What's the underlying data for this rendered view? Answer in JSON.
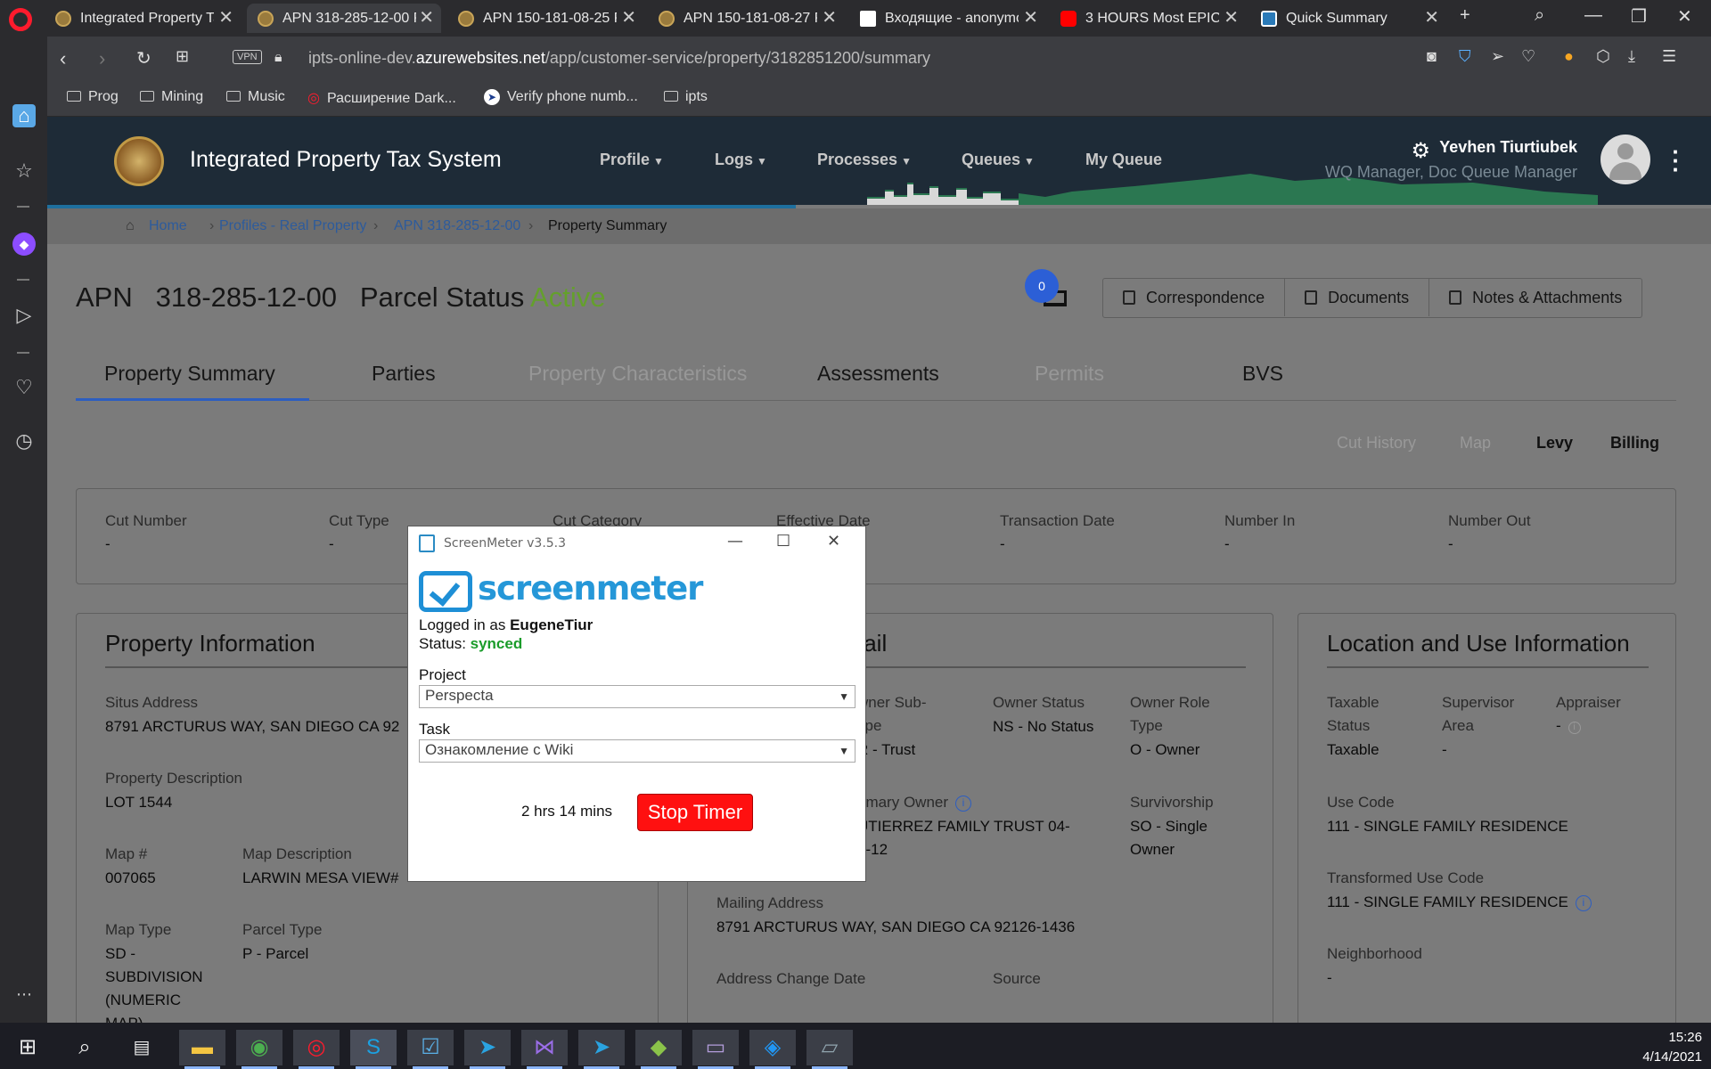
{
  "browser": {
    "tabs": [
      {
        "title": "Integrated Property Ta",
        "active": false,
        "favicon": "seal"
      },
      {
        "title": "APN 318-285-12-00 P",
        "active": true,
        "favicon": "seal"
      },
      {
        "title": "APN 150-181-08-25 P",
        "active": false,
        "favicon": "seal"
      },
      {
        "title": "APN 150-181-08-27 P",
        "active": false,
        "favicon": "seal"
      },
      {
        "title": "Входящие - anonymo",
        "active": false,
        "favicon": "gmail"
      },
      {
        "title": "3 HOURS Most EPIC F",
        "active": false,
        "favicon": "yt"
      },
      {
        "title": "Quick Summary",
        "active": false,
        "favicon": "qs"
      }
    ],
    "url_prefix": "ipts-online-dev.",
    "url_domain": "azurewebsites.net",
    "url_path": "/app/customer-service/property/3182851200/summary",
    "vpn_label": "VPN",
    "bookmarks": [
      "Prog",
      "Mining",
      "Music",
      "Расширение Dark...",
      "Verify phone numb...",
      "ipts"
    ]
  },
  "app": {
    "title": "Integrated Property Tax System",
    "menu": [
      {
        "label": "Profile",
        "dropdown": true
      },
      {
        "label": "Logs",
        "dropdown": true
      },
      {
        "label": "Processes",
        "dropdown": true
      },
      {
        "label": "Queues",
        "dropdown": true
      },
      {
        "label": "My Queue",
        "dropdown": false
      }
    ],
    "user_name": "Yevhen Tiurtiubek",
    "user_role": "WQ Manager, Doc Queue Manager",
    "breadcrumb": [
      "Home",
      "Profiles - Real Property",
      "APN 318-285-12-00",
      "Property Summary"
    ],
    "apn_label": "APN",
    "apn_number": "318-285-12-00",
    "parcel_status_label": "Parcel Status",
    "parcel_status": "Active",
    "notification_count": "0",
    "actions": [
      "Correspondence",
      "Documents",
      "Notes & Attachments"
    ],
    "tabs": [
      {
        "label": "Property Summary",
        "state": "selected"
      },
      {
        "label": "Parties",
        "state": "enabled"
      },
      {
        "label": "Property Characteristics",
        "state": "disabled"
      },
      {
        "label": "Assessments",
        "state": "enabled"
      },
      {
        "label": "Permits",
        "state": "disabled"
      },
      {
        "label": "BVS",
        "state": "enabled"
      }
    ],
    "subtabs": [
      {
        "label": "Cut History",
        "state": "disabled"
      },
      {
        "label": "Map",
        "state": "disabled"
      },
      {
        "label": "Levy",
        "state": "enabled"
      },
      {
        "label": "Billing",
        "state": "enabled"
      }
    ],
    "cut": {
      "fields": [
        {
          "label": "Cut Number",
          "value": "-"
        },
        {
          "label": "Cut Type",
          "value": "-"
        },
        {
          "label": "Cut Category",
          "value": ""
        },
        {
          "label": "Effective Date",
          "value": ""
        },
        {
          "label": "Transaction Date",
          "value": "-"
        },
        {
          "label": "Number In",
          "value": "-"
        },
        {
          "label": "Number Out",
          "value": "-"
        }
      ]
    },
    "property_info": {
      "title": "Property Information",
      "situs_label": "Situs Address",
      "situs_value": "8791 ARCTURUS WAY, SAN DIEGO CA 92",
      "desc_label": "Property Description",
      "desc_value": "LOT 1544",
      "map_num_label": "Map #",
      "map_num_value": "007065",
      "map_desc_label": "Map Description",
      "map_desc_value": "LARWIN MESA VIEW#",
      "map_type_label": "Map Type",
      "map_type_value": "SD - SUBDIVISION (NUMERIC MAP)",
      "parcel_type_label": "Parcel Type",
      "parcel_type_value": "P - Parcel"
    },
    "owner_detail": {
      "title_partial": "tail",
      "owner_sub_label": "wner Sub-\nype",
      "owner_sub_value": "R - Trust",
      "owner_status_label": "Owner Status",
      "owner_status_value": "NS - No Status",
      "owner_role_label": "Owner Role Type",
      "owner_role_value": "O - Owner",
      "primary_owner_label": "rimary Owner",
      "primary_owner_value": "UTIERREZ FAMILY TRUST 04-\n5-12",
      "survivorship_label": "Survivorship",
      "survivorship_value": "SO - Single Owner",
      "mailing_label": "Mailing Address",
      "mailing_value": "8791 ARCTURUS WAY, SAN DIEGO CA 92126-1436",
      "addr_change_label": "Address Change Date",
      "source_label": "Source"
    },
    "location_use": {
      "title": "Location and Use Information",
      "taxable_label": "Taxable Status",
      "taxable_value": "Taxable",
      "supervisor_label": "Supervisor Area",
      "supervisor_value": "-",
      "appraiser_label": "Appraiser",
      "appraiser_value": "-",
      "use_code_label": "Use Code",
      "use_code_value": "111 - SINGLE FAMILY RESIDENCE",
      "transformed_label": "Transformed Use Code",
      "transformed_value": "111 - SINGLE FAMILY RESIDENCE",
      "neighborhood_label": "Neighborhood",
      "neighborhood_value": "-"
    }
  },
  "screenmeter": {
    "window_title": "ScreenMeter v3.5.3",
    "logo_text": "screenmeter",
    "logged_in_prefix": "Logged in as ",
    "username": "EugeneTiur",
    "status_prefix": "Status: ",
    "status": "synced",
    "project_label": "Project",
    "project_value": "Perspecta",
    "task_label": "Task",
    "task_value": "Ознакомление с Wiki",
    "elapsed": "2 hrs 14 mins",
    "stop_label": "Stop Timer"
  },
  "taskbar": {
    "time": "15:26",
    "date": "4/14/2021"
  },
  "colors": {
    "accent_blue": "#2d5ec0",
    "status_active": "#64a02c",
    "stop_red": "#ff1010",
    "synced_green": "#1a9c2a"
  }
}
